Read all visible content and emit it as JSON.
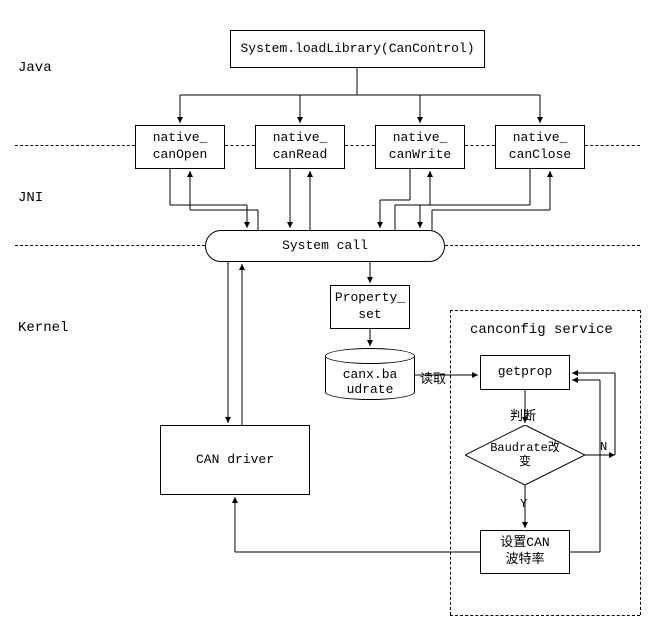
{
  "layers": {
    "java": "Java",
    "jni": "JNI",
    "kernel": "Kernel"
  },
  "top": {
    "load_library": "System.loadLibrary(CanControl)"
  },
  "jni_natives": {
    "canOpen": "native_\ncanOpen",
    "canRead": "native_\ncanRead",
    "canWrite": "native_\ncanWrite",
    "canClose": "native_\ncanClose"
  },
  "syscall": "System call",
  "property_set": "Property_\nset",
  "cylinder": "canx.ba\nudrate",
  "read_label": "读取",
  "service": {
    "title": "canconfig service",
    "getprop": "getprop",
    "judge": "判断",
    "diamond": "Baudrate改\n变",
    "yes": "Y",
    "no": "N",
    "set_baud": "设置CAN\n波特率"
  },
  "can_driver": "CAN driver"
}
